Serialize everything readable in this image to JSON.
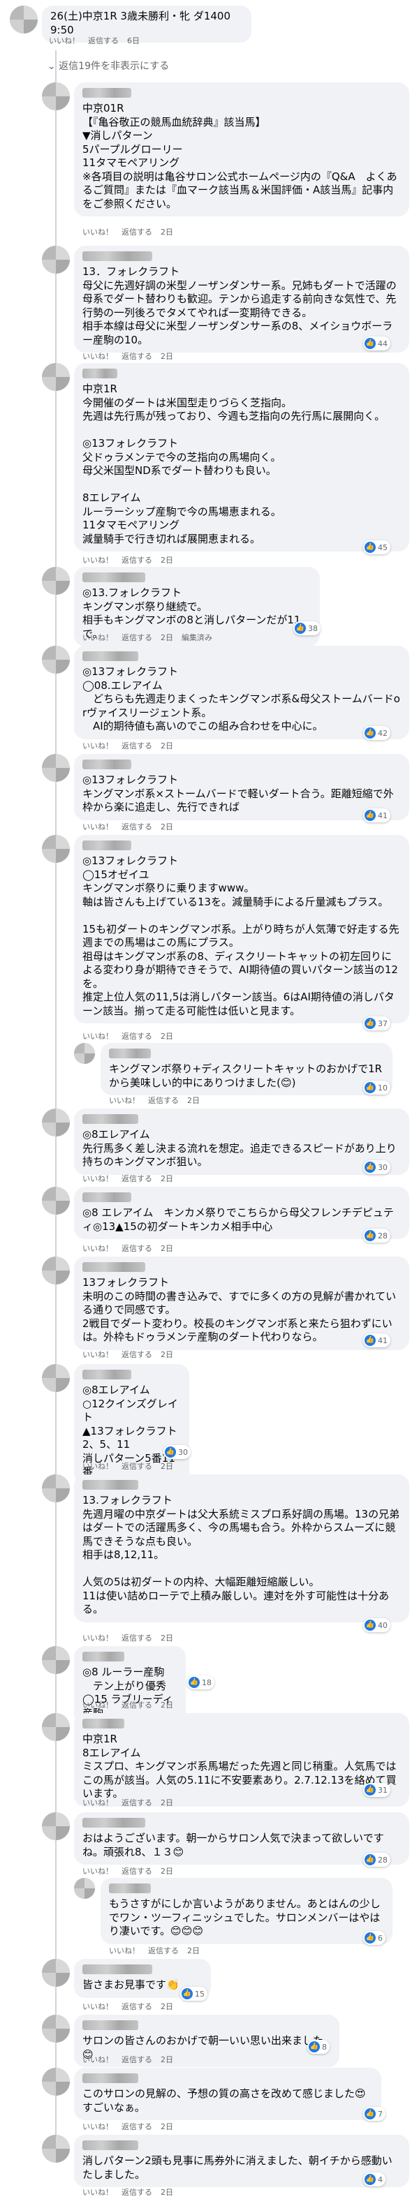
{
  "post": {
    "text": "26(土)中京1R 3歳未勝利・牝 ダ1400 9:50",
    "time": "6日"
  },
  "hide_replies": "⌄ 返信19件を非表示にする",
  "actions": {
    "like": "いいね！",
    "reply": "返信する",
    "edit": "編集済み"
  },
  "comments": [
    {
      "body": "中京01R\n【『亀谷敬正の競馬血統辞典』該当馬】\n▼消しパターン\n5パープルグローリー\n11タマモペアリング\n※各項目の説明は亀谷サロン公式ホームページ内の『Q&A　よくあるご質問』または『血マーク該当馬＆米国評価・A該当馬』記事内をご参照ください。",
      "time": "2日",
      "reactions": ""
    },
    {
      "body": "13．フォレクラフト\n母父に先週好調の米型ノーザンダンサー系。兄姉もダートで活躍の母系でダート替わりも歓迎。テンから追走する前向きな気性で、先行勢の一列後ろでタメてやれば一変期待できる。\n相手本線は母父に米型ノーザンダンサー系の8、メイショウボーラー産駒の10。",
      "time": "2日",
      "reactions": "44"
    },
    {
      "body": "中京1R\n今開催のダートは米国型走りづらく芝指向。\n先週は先行馬が残っており、今週も芝指向の先行馬に展開向く。\n\n◎13フォレクラフト\n父ドゥラメンテで今の芝指向の馬場向く。\n母父米国型ND系でダート替わりも良い。\n\n8エレアイム\nルーラーシップ産駒で今の馬場恵まれる。\n11タマモペアリング\n減量騎手で行き切れば展開恵まれる。",
      "time": "2日",
      "reactions": "45"
    },
    {
      "body": "◎13.フォレクラフト\nキングマンボ祭り継続で。\n相手もキングマンボの8と消しパターンだが11で。",
      "time": "2日",
      "reactions": "38",
      "edited": true
    },
    {
      "body": "◎13フォレクラフト\n◯08.エレアイム\n　どちらも先週走りまくったキングマンボ系&母父ストームバードorヴァイスリージェント系。\n　AI的期待値も高いのでこの組み合わせを中心に。",
      "time": "2日",
      "reactions": "42"
    },
    {
      "body": "◎13フォレクラフト\nキングマンボ系×ストームバードで軽いダート合う。距離短縮で外枠から楽に追走し、先行できれば",
      "time": "2日",
      "reactions": "41"
    },
    {
      "body": "◎13フォレクラフト\n◯15オゼイユ\nキングマンボ祭りに乗りますwww。\n軸は皆さんも上げている13を。減量騎手による斤量減もプラス。\n\n15も初ダートのキングマンボ系。上がり時ちが人気薄で好走する先週までの馬場はこの馬にプラス。\n祖母はキングマンボ系の8、ディスクリートキャットの初左回りによる変わり身が期待できそうで、AI期待値の買いパターン該当の12を。\n推定上位人気の11,5は消しパターン該当。6はAI期待値の消しパターン該当。揃って走る可能性は低いと見ます。",
      "time": "2日",
      "reactions": "37"
    },
    {
      "body": "キングマンボ祭り+ディスクリートキャットのおかげで1Rから美味しい的中にありつけました(😊)",
      "time": "2日",
      "reactions": "10",
      "nested": true
    },
    {
      "body": "◎8エレアイム\n先行馬多く差し決まる流れを想定。追走できるスピードがあり上り持ちのキングマンボ狙い。",
      "time": "2日",
      "reactions": "30"
    },
    {
      "body": "◎8 エレアイム　キンカメ祭りでこちらから母父フレンチデピュティ◎13▲15の初ダートキンカメ相手中心",
      "time": "2日",
      "reactions": "28"
    },
    {
      "body": "13フォレクラフト\n未明のこの時間の書き込みで、すでに多くの方の見解が書かれている通りで同感です。\n2戦目でダート変わり。校長のキングマンボ系と来たら狙わずにいは。外枠もドゥラメンテ産駒のダート代わりなら。",
      "time": "2日",
      "reactions": "41"
    },
    {
      "body": "◎8エレアイム\n○12クインズグレイト\n▲13フォレクラフト\n2、5、11\n消しパターン5番11番",
      "time": "2日",
      "reactions": "30"
    },
    {
      "body": "13.フォレクラフト\n先週月曜の中京ダートは父大系統ミスプロ系好調の馬場。13の兄弟はダートでの活躍馬多く、今の馬場も合う。外枠からスムーズに競馬できそうな点も良い。\n相手は8,12,11。\n\n人気の5は初ダートの内枠、大幅距離短縮厳しい。\n11は使い詰めローテで上積み厳しい。連対を外す可能性は十分ある。",
      "time": "2日",
      "reactions": "40"
    },
    {
      "body": "◎8 ルーラー産駒\n　テン上がり優秀\n◯15 ラブリーディ産駒",
      "time": "2日",
      "reactions": "18"
    },
    {
      "body": "中京1R\n8エレアイム\nミスプロ、キングマンボ系馬場だった先週と同じ稍重。人気馬ではこの馬が該当。人気の5.11に不安要素あり。2.7.12.13を絡めて買います。",
      "time": "2日",
      "reactions": "31"
    },
    {
      "body": "おはようございます。朝一からサロン人気で決まって欲しいですね。頑張れ8、１３😊",
      "time": "2日",
      "reactions": "28"
    },
    {
      "body": "もうさすがにしか言いようがありません。あとはんの少しでワン・ツーフィニッシュでした。サロンメンバーはやはり凄いです。😊😊😊",
      "time": "2日",
      "reactions": "6",
      "nested": true
    },
    {
      "body": "皆さまお見事です👏",
      "time": "2日",
      "reactions": "15"
    },
    {
      "body": "サロンの皆さんのおかげで朝一いい思い出来ました😊",
      "time": "2日",
      "reactions": "8"
    },
    {
      "body": "このサロンの見解の、予想の質の高さを改めて感じました😍すごいなぁ。",
      "time": "2日",
      "reactions": "7"
    },
    {
      "body": "消しパターン2頭も見事に馬券外に消えました、朝イチから感動いたしました。",
      "time": "2日",
      "reactions": "4"
    }
  ]
}
